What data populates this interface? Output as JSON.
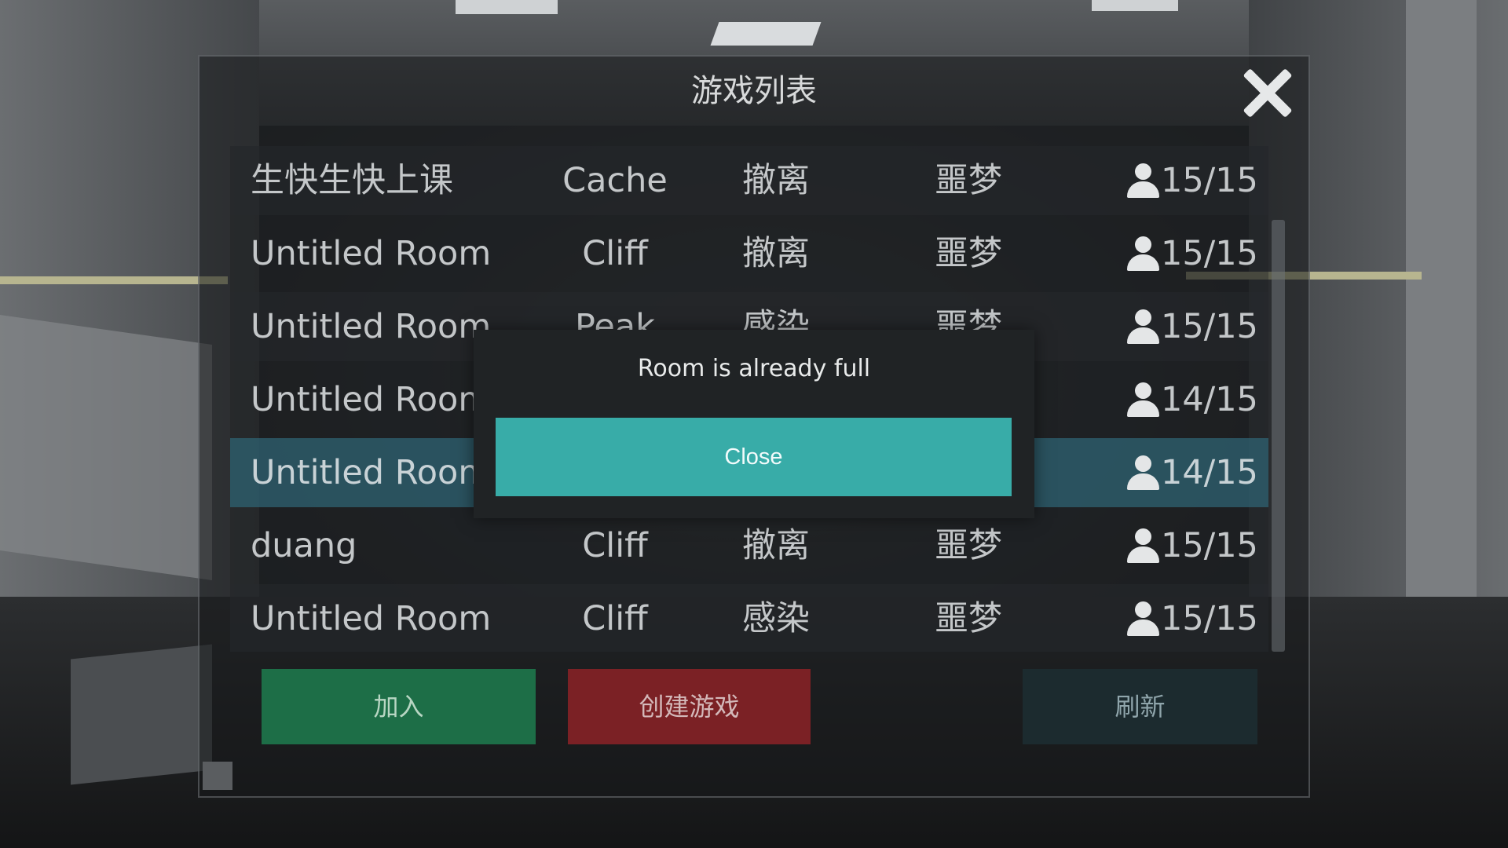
{
  "window": {
    "title": "游戏列表"
  },
  "rooms": [
    {
      "name": "生快生快上课",
      "map": "Cache",
      "mode": "撤离",
      "difficulty": "噩梦",
      "players": "15/15"
    },
    {
      "name": "Untitled Room",
      "map": "Cliff",
      "mode": "撤离",
      "difficulty": "噩梦",
      "players": "15/15"
    },
    {
      "name": "Untitled Room",
      "map": "Peak",
      "mode": "感染",
      "difficulty": "噩梦",
      "players": "15/15"
    },
    {
      "name": "Untitled Room",
      "map": "",
      "mode": "",
      "difficulty": "",
      "players": "14/15"
    },
    {
      "name": "Untitled Room",
      "map": "",
      "mode": "",
      "difficulty": "",
      "players": "14/15",
      "selected": true
    },
    {
      "name": "duang",
      "map": "Cliff",
      "mode": "撤离",
      "difficulty": "噩梦",
      "players": "15/15"
    },
    {
      "name": "Untitled Room",
      "map": "Cliff",
      "mode": "感染",
      "difficulty": "噩梦",
      "players": "15/15"
    }
  ],
  "buttons": {
    "join": "加入",
    "create": "创建游戏",
    "refresh": "刷新"
  },
  "dialog": {
    "message": "Room is already full",
    "close_label": "Close"
  },
  "colors": {
    "accent": "#38aca8",
    "join": "#1d6e47",
    "create": "#7b2125",
    "selected_row": "#2e6070"
  },
  "icons": {
    "close": "close-icon",
    "player": "user-icon"
  }
}
